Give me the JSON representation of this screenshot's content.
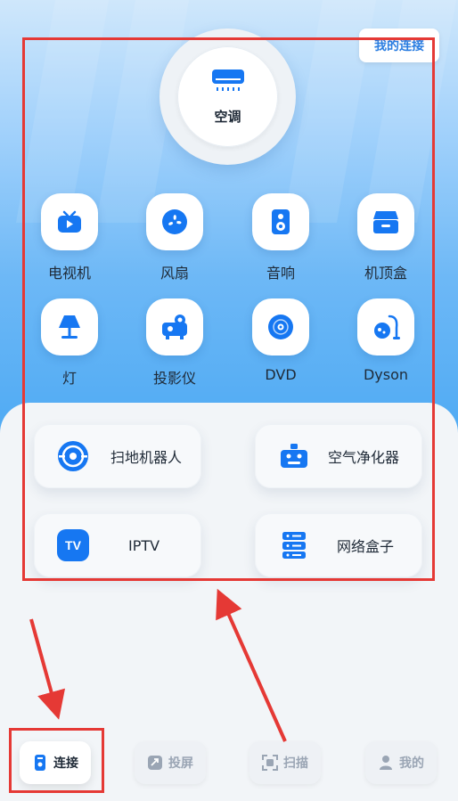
{
  "header": {
    "my_connection": "我的连接"
  },
  "featured": {
    "label": "空调",
    "icon": "air-conditioner-icon"
  },
  "devices": [
    {
      "label": "电视机",
      "icon": "tv-icon"
    },
    {
      "label": "风扇",
      "icon": "fan-icon"
    },
    {
      "label": "音响",
      "icon": "speaker-icon"
    },
    {
      "label": "机顶盒",
      "icon": "set-top-box-icon"
    },
    {
      "label": "灯",
      "icon": "lamp-icon"
    },
    {
      "label": "投影仪",
      "icon": "projector-icon"
    },
    {
      "label": "DVD",
      "icon": "dvd-icon"
    },
    {
      "label": "Dyson",
      "icon": "vacuum-icon"
    }
  ],
  "cards": [
    {
      "label": "扫地机器人",
      "icon": "robot-vacuum-icon"
    },
    {
      "label": "空气净化器",
      "icon": "air-purifier-icon"
    },
    {
      "label": "IPTV",
      "icon": "iptv-icon",
      "badge": "TV"
    },
    {
      "label": "网络盒子",
      "icon": "network-box-icon"
    }
  ],
  "nav": [
    {
      "label": "连接",
      "icon": "remote-icon",
      "active": true
    },
    {
      "label": "投屏",
      "icon": "screen-cast-icon",
      "active": false
    },
    {
      "label": "扫描",
      "icon": "scan-icon",
      "active": false
    },
    {
      "label": "我的",
      "icon": "user-icon",
      "active": false
    }
  ],
  "colors": {
    "accent": "#1677f2",
    "annotation": "#e53935",
    "gradient_top": "#cfe7fb",
    "gradient_bottom": "#4aa8f3"
  }
}
